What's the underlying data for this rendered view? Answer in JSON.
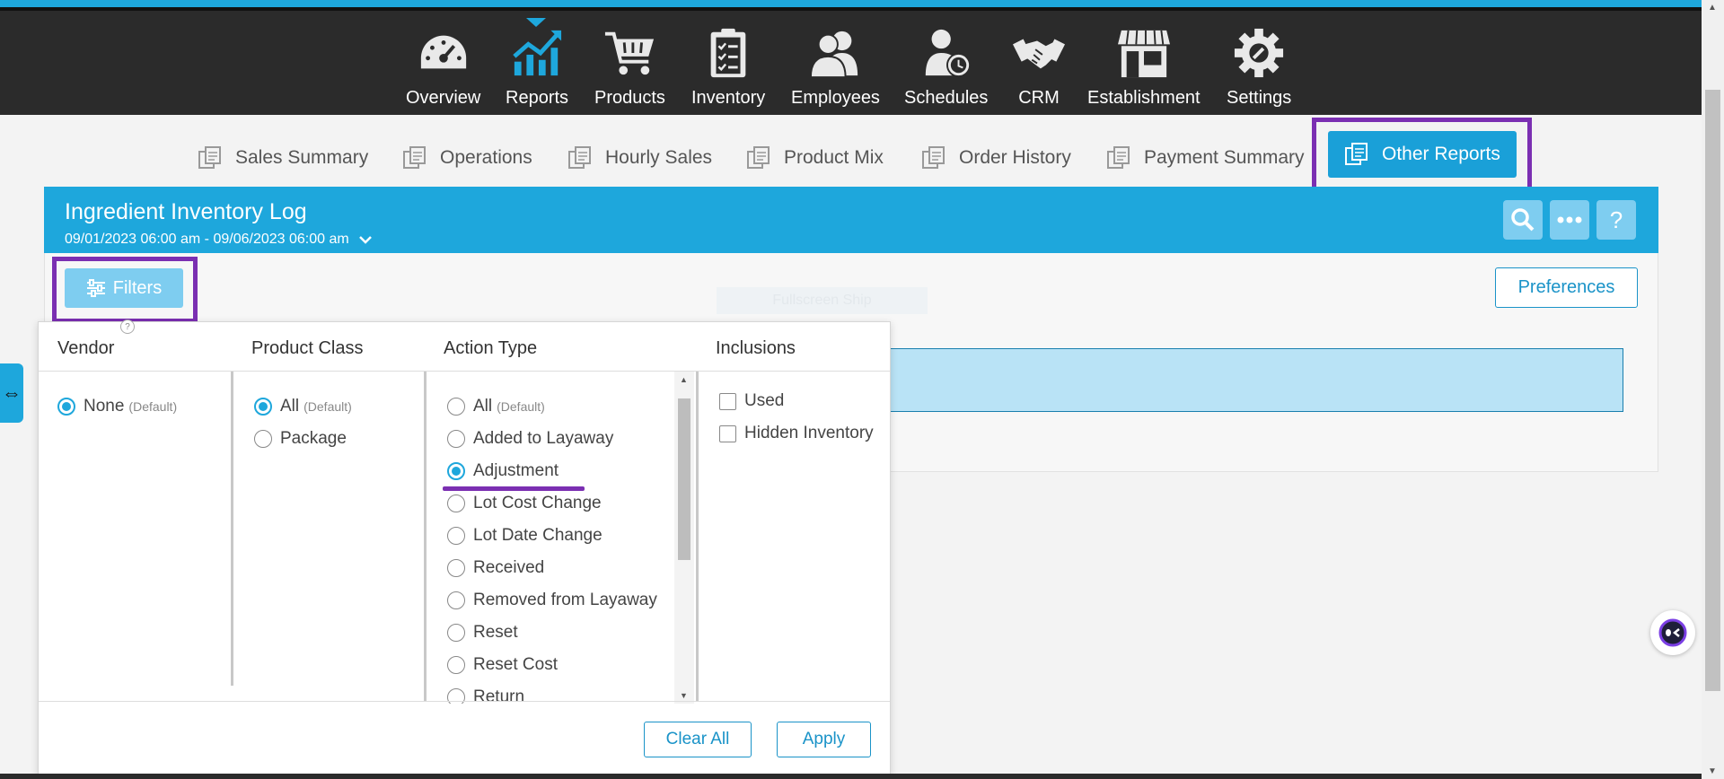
{
  "nav": {
    "items": [
      {
        "label": "Overview",
        "icon": "speedometer-icon"
      },
      {
        "label": "Reports",
        "icon": "chart-icon",
        "active": true
      },
      {
        "label": "Products",
        "icon": "cart-icon"
      },
      {
        "label": "Inventory",
        "icon": "clipboard-icon"
      },
      {
        "label": "Employees",
        "icon": "people-icon"
      },
      {
        "label": "Schedules",
        "icon": "person-clock-icon"
      },
      {
        "label": "CRM",
        "icon": "handshake-icon"
      },
      {
        "label": "Establishment",
        "icon": "storefront-icon"
      },
      {
        "label": "Settings",
        "icon": "gear-icon"
      }
    ]
  },
  "subtabs": [
    {
      "label": "Sales Summary"
    },
    {
      "label": "Operations"
    },
    {
      "label": "Hourly Sales"
    },
    {
      "label": "Product Mix"
    },
    {
      "label": "Order History"
    },
    {
      "label": "Payment Summary"
    },
    {
      "label": "Other Reports",
      "active": true
    }
  ],
  "report": {
    "title": "Ingredient Inventory Log",
    "range": "09/01/2023 06:00 am - 09/06/2023 06:00 am",
    "filters_label": "Filters",
    "preferences_label": "Preferences",
    "ghost_text": "Fullscreen Ship"
  },
  "filters": {
    "columns": {
      "vendor": "Vendor",
      "product_class": "Product Class",
      "action_type": "Action Type",
      "inclusions": "Inclusions"
    },
    "help": "?",
    "default_tag": "(Default)",
    "vendor_options": [
      {
        "label": "None",
        "selected": true,
        "default": true
      }
    ],
    "product_class_options": [
      {
        "label": "All",
        "selected": true,
        "default": true
      },
      {
        "label": "Package",
        "selected": false
      }
    ],
    "action_type_options": [
      {
        "label": "All",
        "selected": false,
        "default": true
      },
      {
        "label": "Added to Layaway",
        "selected": false
      },
      {
        "label": "Adjustment",
        "selected": true
      },
      {
        "label": "Lot Cost Change",
        "selected": false
      },
      {
        "label": "Lot Date Change",
        "selected": false
      },
      {
        "label": "Received",
        "selected": false
      },
      {
        "label": "Removed from Layaway",
        "selected": false
      },
      {
        "label": "Reset",
        "selected": false
      },
      {
        "label": "Reset Cost",
        "selected": false
      },
      {
        "label": "Return",
        "selected": false
      }
    ],
    "inclusions": [
      {
        "label": "Used",
        "checked": false
      },
      {
        "label": "Hidden Inventory",
        "checked": false
      }
    ],
    "clear_label": "Clear All",
    "apply_label": "Apply"
  },
  "colors": {
    "accent": "#1ea7dc",
    "highlight": "#7b2fb2",
    "nav_bg": "#2b2b2b"
  }
}
